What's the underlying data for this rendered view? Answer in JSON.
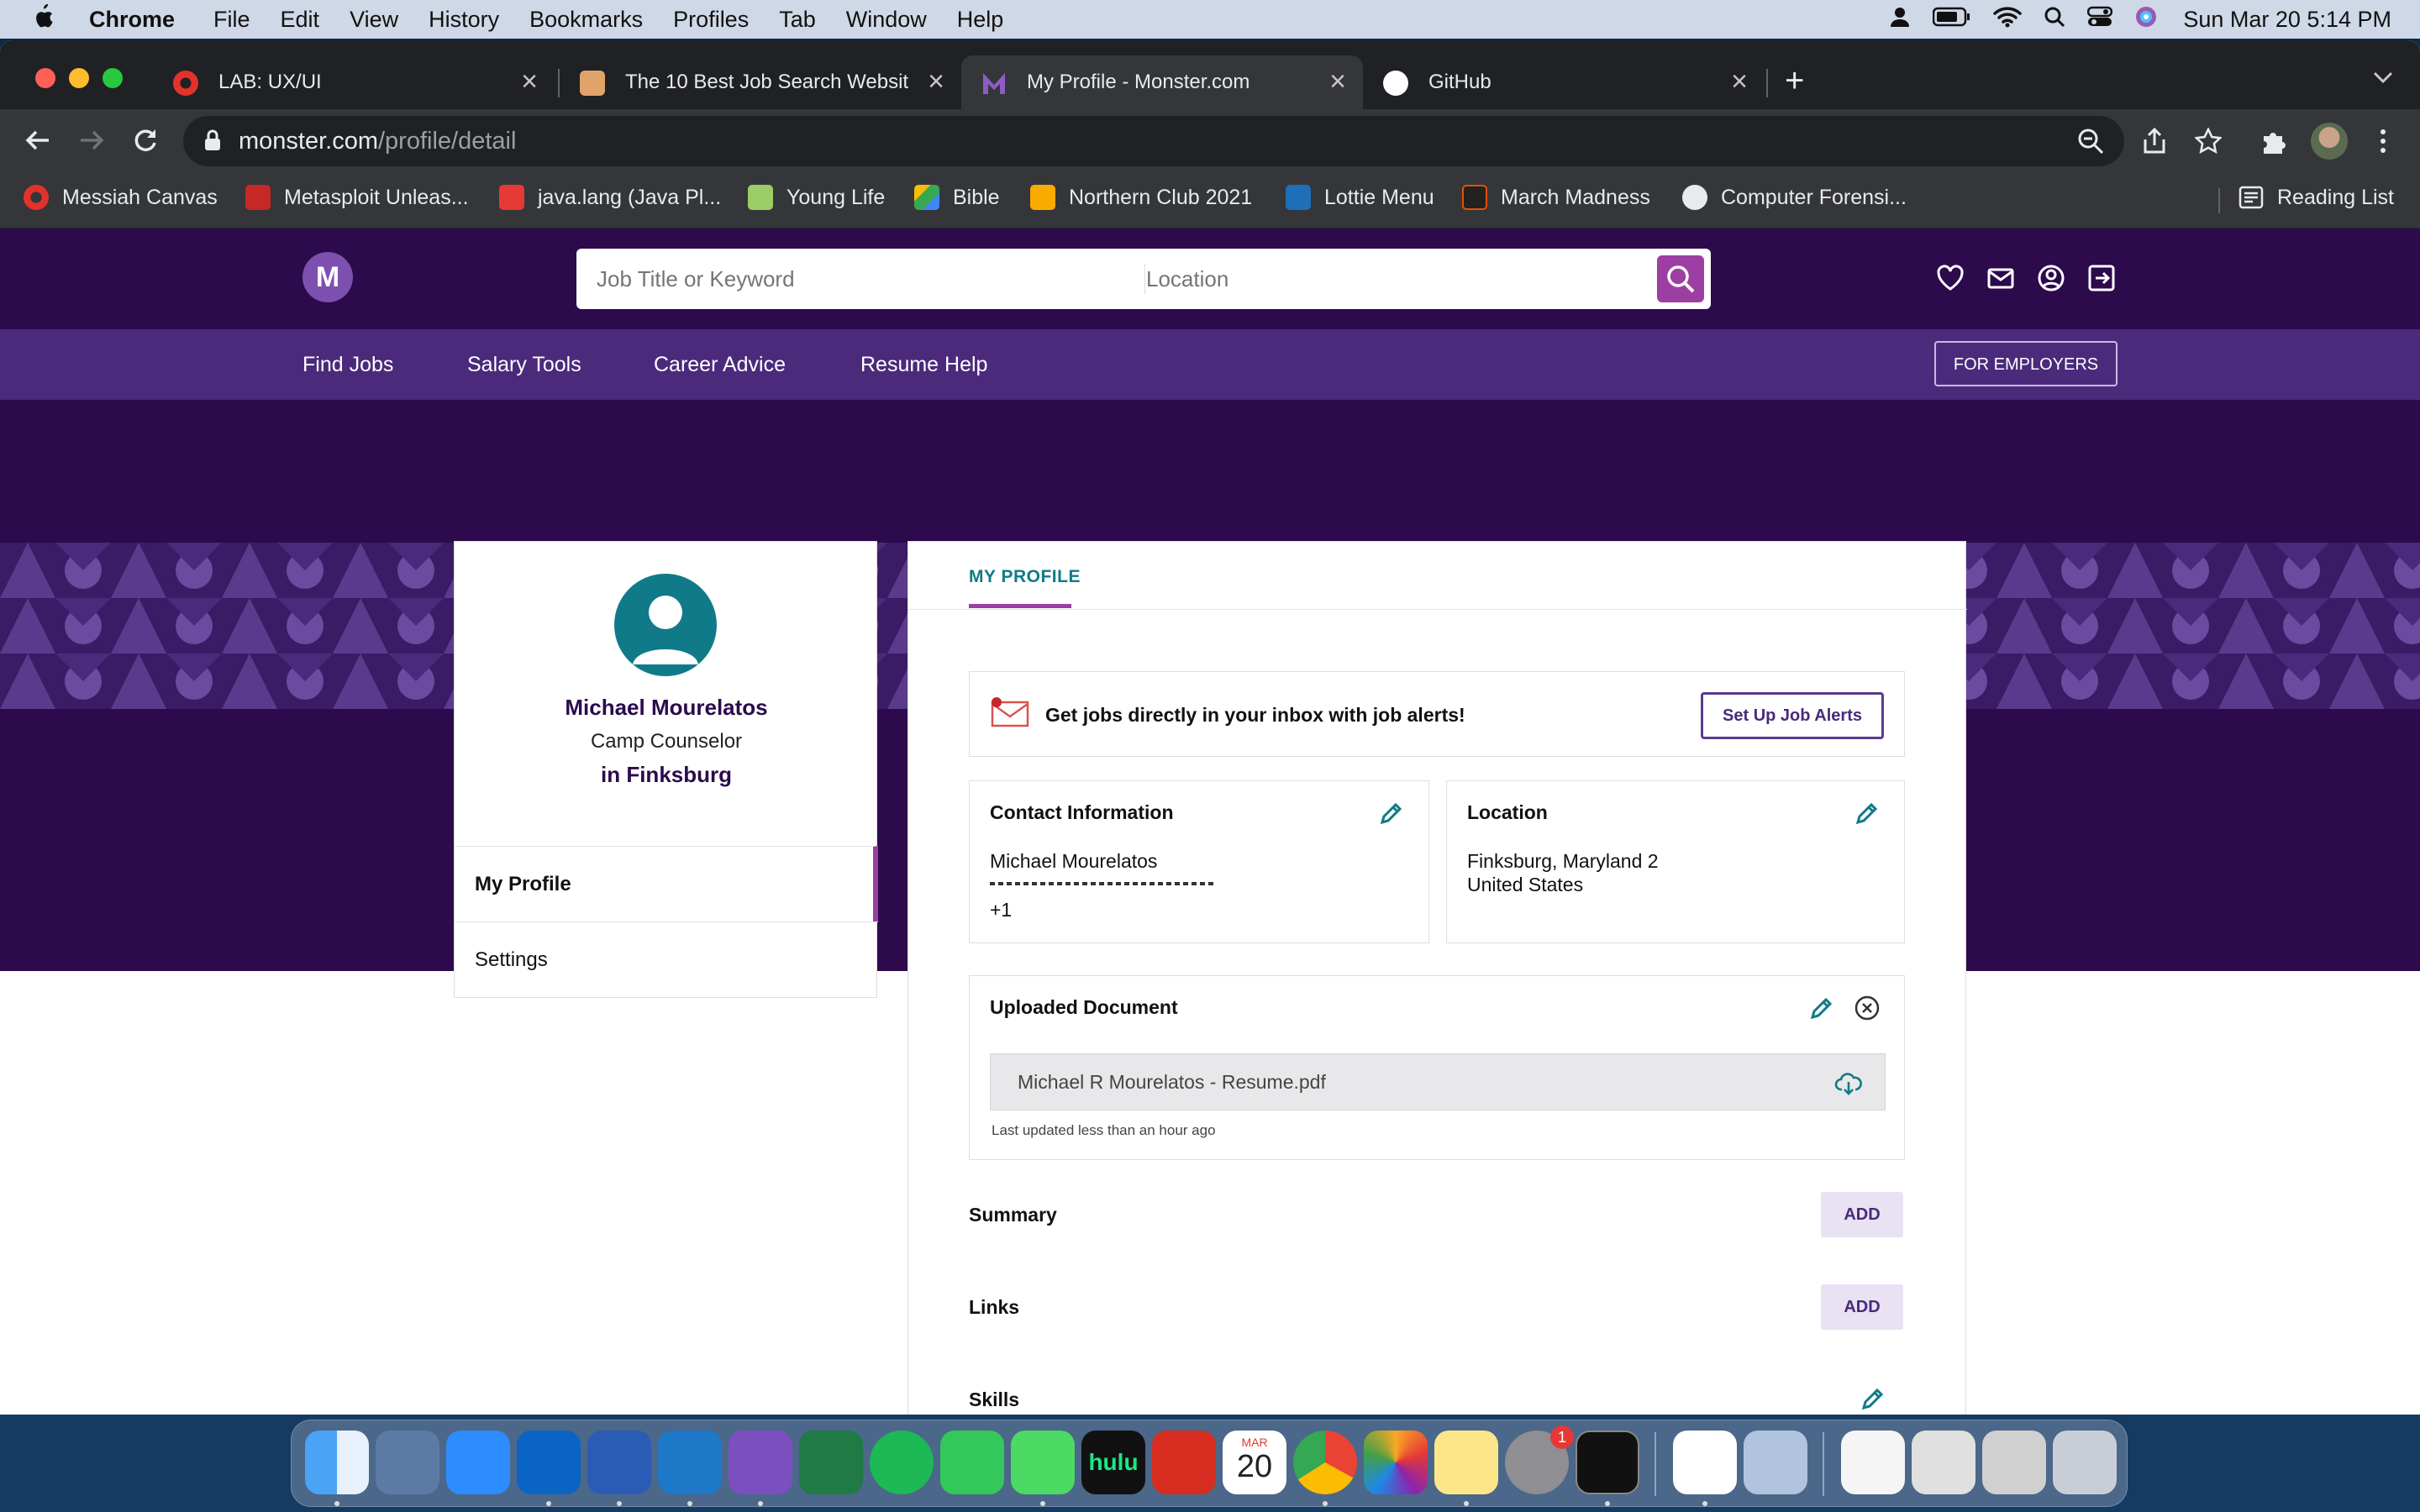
{
  "menubar": {
    "app": "Chrome",
    "items": [
      "File",
      "Edit",
      "View",
      "History",
      "Bookmarks",
      "Profiles",
      "Tab",
      "Window",
      "Help"
    ],
    "datetime": "Sun Mar 20  5:14 PM"
  },
  "tabs": [
    {
      "title": "LAB: UX/UI"
    },
    {
      "title": "The 10 Best Job Search Websit"
    },
    {
      "title": "My Profile - Monster.com"
    },
    {
      "title": "GitHub"
    }
  ],
  "address": {
    "host": "monster.com",
    "path": "/profile/detail"
  },
  "bookmarks": [
    "Messiah Canvas",
    "Metasploit Unleas...",
    "java.lang (Java Pl...",
    "Young Life",
    "Bible",
    "Northern Club 2021",
    "Lottie Menu",
    "March Madness",
    "Computer Forensi..."
  ],
  "reading_list": "Reading List",
  "site": {
    "logo": "M",
    "search_placeholder": "Job Title or Keyword",
    "location_placeholder": "Location",
    "nav": [
      "Find Jobs",
      "Salary Tools",
      "Career Advice",
      "Resume Help"
    ],
    "employers": "FOR EMPLOYERS"
  },
  "profile": {
    "name": "Michael Mourelatos",
    "title": "Camp Counselor",
    "location": "in Finksburg",
    "menu": [
      "My Profile",
      "Settings"
    ]
  },
  "main": {
    "tab": "MY PROFILE",
    "alert_text": "Get jobs directly in your inbox with job alerts!",
    "alert_button": "Set Up Job Alerts",
    "contact_title": "Contact Information",
    "contact_name": "Michael Mourelatos",
    "contact_phone": "+1",
    "location_title": "Location",
    "location_line1": "Finksburg, Maryland 2",
    "location_line2": "United States",
    "upload_title": "Uploaded Document",
    "file_name": "Michael R Mourelatos - Resume.pdf",
    "updated": "Last updated less than an hour ago",
    "summary": "Summary",
    "links": "Links",
    "skills": "Skills",
    "add": "ADD"
  },
  "dock": {
    "hulu": "hulu",
    "calendar_month": "MAR",
    "calendar_day": "20",
    "badge": "1"
  },
  "colors": {
    "header": "#2c0a4c",
    "nav": "#4b2a7c",
    "accent": "#9d3ea3",
    "teal": "#117a88"
  }
}
